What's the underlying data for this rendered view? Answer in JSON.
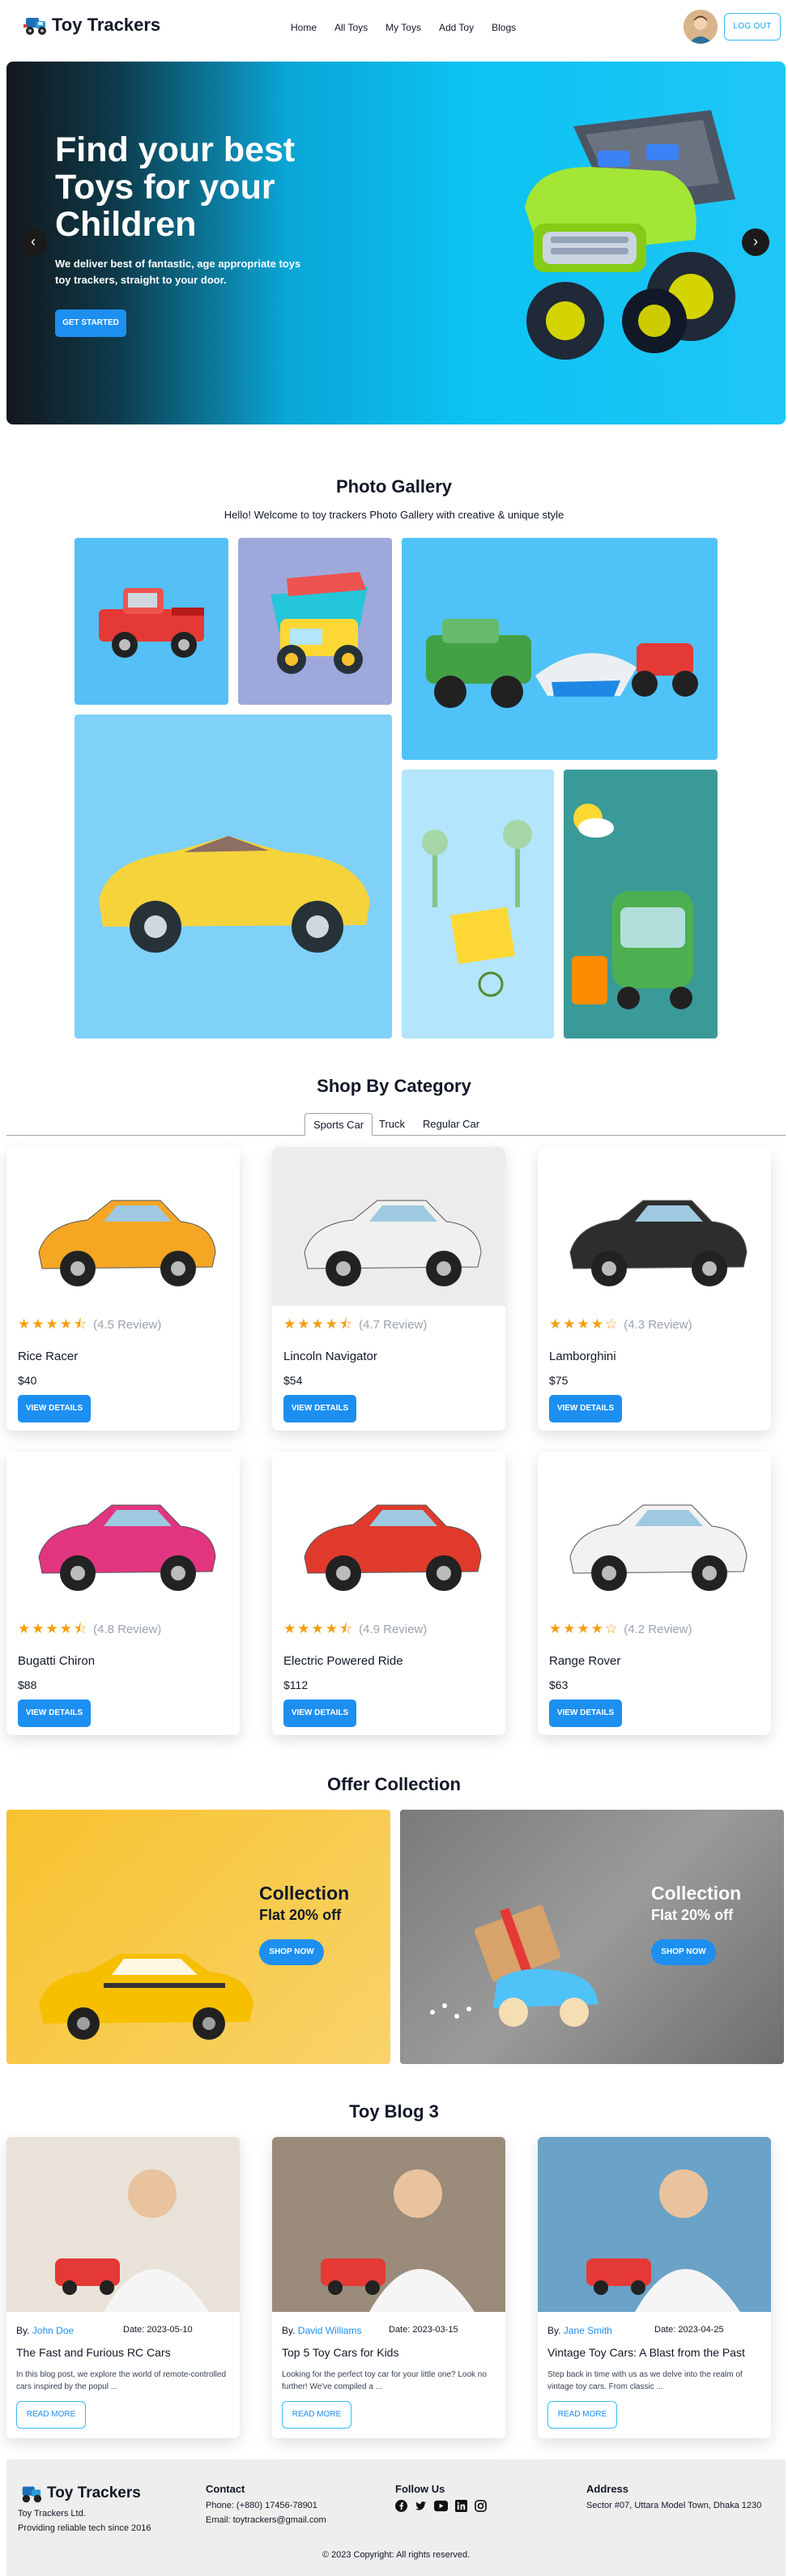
{
  "brand": {
    "name": "Toy Trackers"
  },
  "nav": {
    "links": [
      "Home",
      "All Toys",
      "My Toys",
      "Add Toy",
      "Blogs"
    ],
    "logout_label": "LOG OUT"
  },
  "hero": {
    "title": "Find your best Toys for your Children",
    "description": "We deliver best of fantastic, age appropriate toys toy trackers, straight to your door.",
    "cta_label": "GET STARTED",
    "prev_icon": "chevron-left-icon",
    "next_icon": "chevron-right-icon"
  },
  "gallery": {
    "title": "Photo Gallery",
    "subtitle": "Hello! Welcome to toy trackers Photo Gallery with creative & unique style"
  },
  "category": {
    "title": "Shop By Category",
    "tabs": [
      "Sports Car",
      "Truck",
      "Regular Car"
    ],
    "active_tab": "Sports Car",
    "button_label": "VIEW DETAILS",
    "products": [
      {
        "name": "Rice Racer",
        "price": "$40",
        "rating": 4.5,
        "rating_text": "(4.5 Review)"
      },
      {
        "name": "Lincoln Navigator",
        "price": "$54",
        "rating": 4.7,
        "rating_text": "(4.7 Review)"
      },
      {
        "name": "Lamborghini",
        "price": "$75",
        "rating": 4.3,
        "rating_text": "(4.3 Review)"
      },
      {
        "name": "Bugatti Chiron",
        "price": "$88",
        "rating": 4.8,
        "rating_text": "(4.8 Review)"
      },
      {
        "name": "Electric Powered Ride",
        "price": "$112",
        "rating": 4.9,
        "rating_text": "(4.9 Review)"
      },
      {
        "name": "Range Rover",
        "price": "$63",
        "rating": 4.2,
        "rating_text": "(4.2 Review)"
      }
    ]
  },
  "offers": {
    "title": "Offer Collection",
    "items": [
      {
        "title": "Collection",
        "prefix": "Flat",
        "discount": "20%",
        "suffix": "off",
        "cta": "SHOP NOW"
      },
      {
        "title": "Collection",
        "prefix": "Flat",
        "discount": "20%",
        "suffix": "off",
        "cta": "SHOP NOW"
      }
    ]
  },
  "blog": {
    "title": "Toy Blog 3",
    "by_label": "By.",
    "date_label": "Date:",
    "button_label": "READ MORE",
    "posts": [
      {
        "author": "John Doe",
        "date": "2023-05-10",
        "title": "The Fast and Furious RC Cars",
        "excerpt": "In this blog post, we explore the world of remote-controlled cars inspired by the popul ..."
      },
      {
        "author": "David Williams",
        "date": "2023-03-15",
        "title": "Top 5 Toy Cars for Kids",
        "excerpt": "Looking for the perfect toy car for your little one? Look no further! We've compiled a ..."
      },
      {
        "author": "Jane Smith",
        "date": "2023-04-25",
        "title": "Vintage Toy Cars: A Blast from the Past",
        "excerpt": "Step back in time with us as we delve into the realm of vintage toy cars. From classic ..."
      }
    ]
  },
  "footer": {
    "brand": "Toy Trackers",
    "company": "Toy Trackers Ltd.",
    "tagline": "Providing reliable tech since 2016",
    "contact_title": "Contact",
    "phone": "Phone: (+880) 17456-78901",
    "email": "Email: toytrackers@gmail.com",
    "follow_title": "Follow Us",
    "social_icons": [
      "facebook-icon",
      "twitter-icon",
      "youtube-icon",
      "linkedin-icon",
      "instagram-icon"
    ],
    "address_title": "Address",
    "address": "Sector #07, Uttara Model Town, Dhaka 1230",
    "copyright": "© 2023 Copyright: All rights reserved."
  },
  "colors": {
    "accent": "#1d8ff0",
    "star": "#f59e0b",
    "hero_bg": "#0cc3f2",
    "footer_bg": "#eeeeee"
  }
}
